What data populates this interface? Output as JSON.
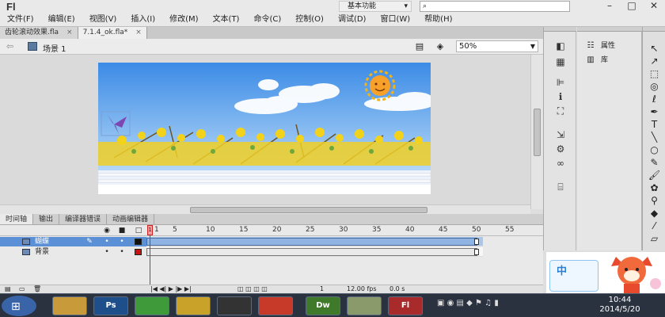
{
  "app": {
    "logo": "Fl",
    "workspace": "基本功能",
    "search_placeholder": "",
    "window_buttons": [
      "–",
      "□",
      "✕"
    ]
  },
  "menu": [
    "文件(F)",
    "编辑(E)",
    "视图(V)",
    "插入(I)",
    "修改(M)",
    "文本(T)",
    "命令(C)",
    "控制(O)",
    "调试(D)",
    "窗口(W)",
    "帮助(H)"
  ],
  "tabs": [
    {
      "label": "齿轮滚动效果.fla",
      "close": "×"
    },
    {
      "label": "7.1.4_ok.fla*",
      "close": "×"
    }
  ],
  "scene": {
    "label": "场景 1",
    "zoom": "50%"
  },
  "timeline": {
    "tabs": [
      "时间轴",
      "输出",
      "编译器错误",
      "动画编辑器"
    ],
    "ruler": [
      "1",
      "5",
      "10",
      "15",
      "20",
      "25",
      "30",
      "35",
      "40",
      "45",
      "50",
      "55"
    ],
    "playhead_label": "1",
    "layers": [
      {
        "name": "蝴蝶",
        "selected": true,
        "color": "#111111"
      },
      {
        "name": "背景",
        "selected": false,
        "color": "#cc1111"
      }
    ],
    "status": {
      "frame": "1",
      "fps": "12.00 fps",
      "time": "0.0 s"
    }
  },
  "props_panel": {
    "items": [
      "属性",
      "库"
    ]
  },
  "mascot": {
    "label": "中"
  },
  "taskbar": {
    "apps": [
      "",
      "Ps",
      "",
      "",
      "",
      "",
      "Dw",
      "",
      "Fl"
    ],
    "time": "10:44",
    "date": "2014/5/20"
  }
}
